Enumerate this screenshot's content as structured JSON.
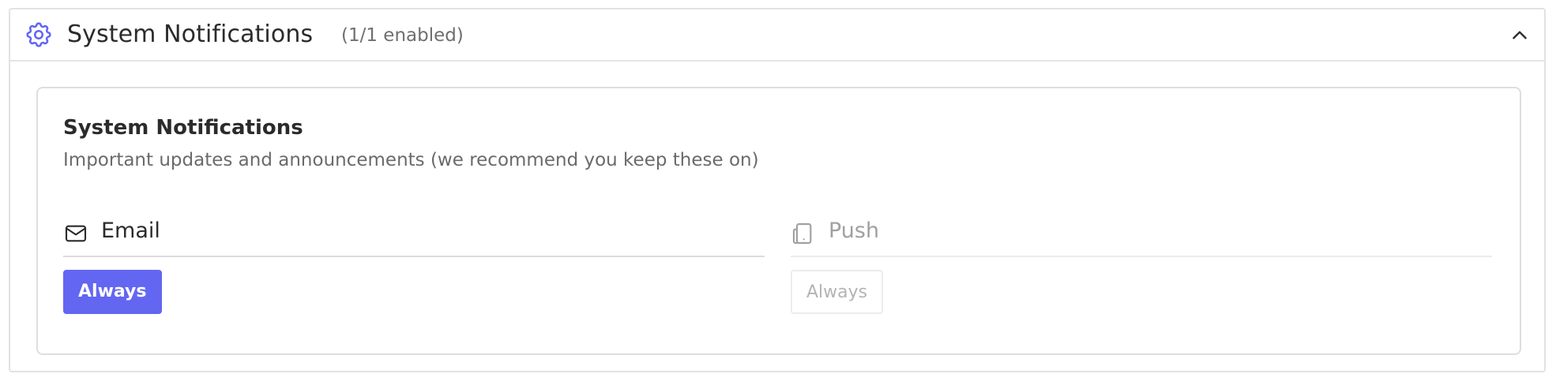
{
  "colors": {
    "accent": "#6366f1",
    "header_icon": "#6366f1"
  },
  "section": {
    "title": "System Notifications",
    "count": "(1/1 enabled)",
    "icon": "gear-icon",
    "toggle_icon": "chevron-up-icon"
  },
  "card": {
    "title": "System Notifications",
    "description": "Important updates and announcements (we recommend you keep these on)",
    "channels": [
      {
        "label": "Email",
        "icon": "mail-icon",
        "button_label": "Always",
        "enabled": true
      },
      {
        "label": "Push",
        "icon": "mobile-device-icon",
        "button_label": "Always",
        "enabled": false
      }
    ]
  }
}
